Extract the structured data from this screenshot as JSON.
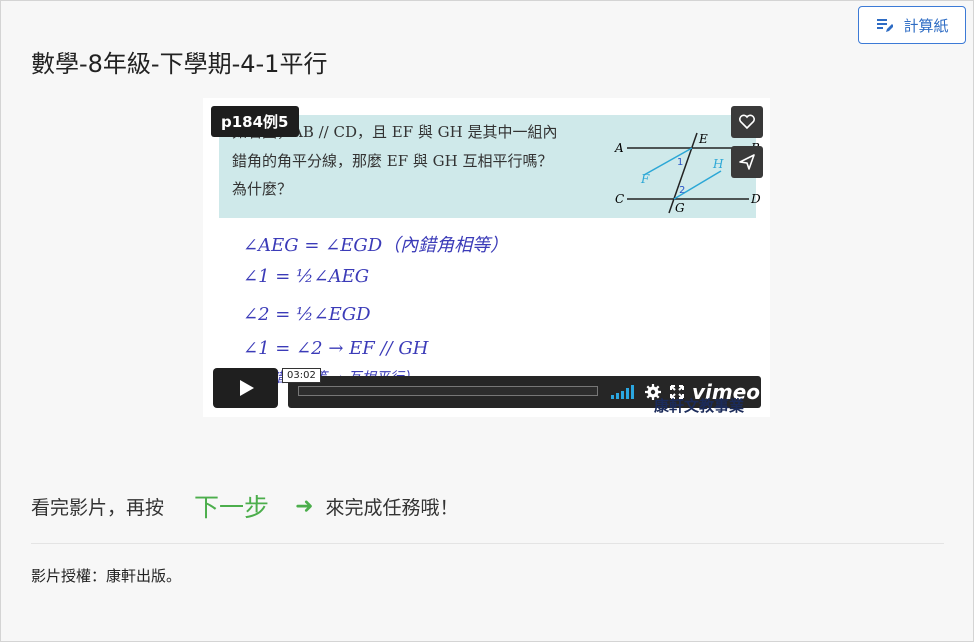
{
  "toolbar": {
    "calc_label": "計算紙"
  },
  "page": {
    "title": "數學-8年級-下學期-4-1平行"
  },
  "video": {
    "badge": "p184例5",
    "question_line1": "如右圖，AB // CD，且 EF 與 GH 是其中一組內",
    "question_line2": "錯角的角平分線，那麼 EF 與 GH 互相平行嗎？",
    "question_line3": "為什麼？",
    "diagram_labels": {
      "A": "A",
      "B": "B",
      "C": "C",
      "D": "D",
      "E": "E",
      "F": "F",
      "G": "G",
      "H": "H",
      "one": "1",
      "two": "2"
    },
    "handwriting": [
      "∠AEG = ∠EGD（內錯角相等）",
      "∠1 = ½∠AEG",
      "∠2 = ½∠EGD",
      "∠1 = ∠2  →  EF // GH",
      "（內錯角相等 → 互相平行）"
    ],
    "timecode": "03:02",
    "player_brand": "vimeo",
    "publisher_logo": "康軒文教事業",
    "progress": 0.0,
    "volume_level": 1.0
  },
  "instruction": {
    "before": "看完影片，再按",
    "next_label": "下一步",
    "arrow": "➜",
    "after": "來完成任務哦！"
  },
  "footer": {
    "copyright": "影片授權：康軒出版。"
  },
  "colors": {
    "accent_blue": "#3c7ad6",
    "next_green": "#4cae4c",
    "panel": "#cfe9ea"
  }
}
